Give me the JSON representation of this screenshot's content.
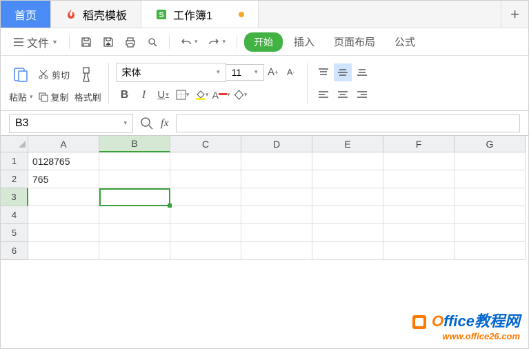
{
  "tabs": {
    "home": "首页",
    "template": "稻壳模板",
    "workbook": "工作簿1"
  },
  "toolbar": {
    "file": "文件",
    "start": "开始",
    "insert": "插入",
    "layout": "页面布局",
    "formula": "公式"
  },
  "ribbon": {
    "paste": "粘贴",
    "cut": "剪切",
    "copy": "复制",
    "format_painter": "格式刷",
    "font_name": "宋体",
    "font_size": "11"
  },
  "namebox": "B3",
  "columns": [
    "A",
    "B",
    "C",
    "D",
    "E",
    "F",
    "G"
  ],
  "rows": [
    "1",
    "2",
    "3",
    "4",
    "5",
    "6"
  ],
  "cells": {
    "A1": "0128765",
    "A2": "765"
  },
  "watermark": {
    "brand_prefix": "O",
    "brand_suffix": "ffice教程网",
    "url": "www.office26.com"
  }
}
